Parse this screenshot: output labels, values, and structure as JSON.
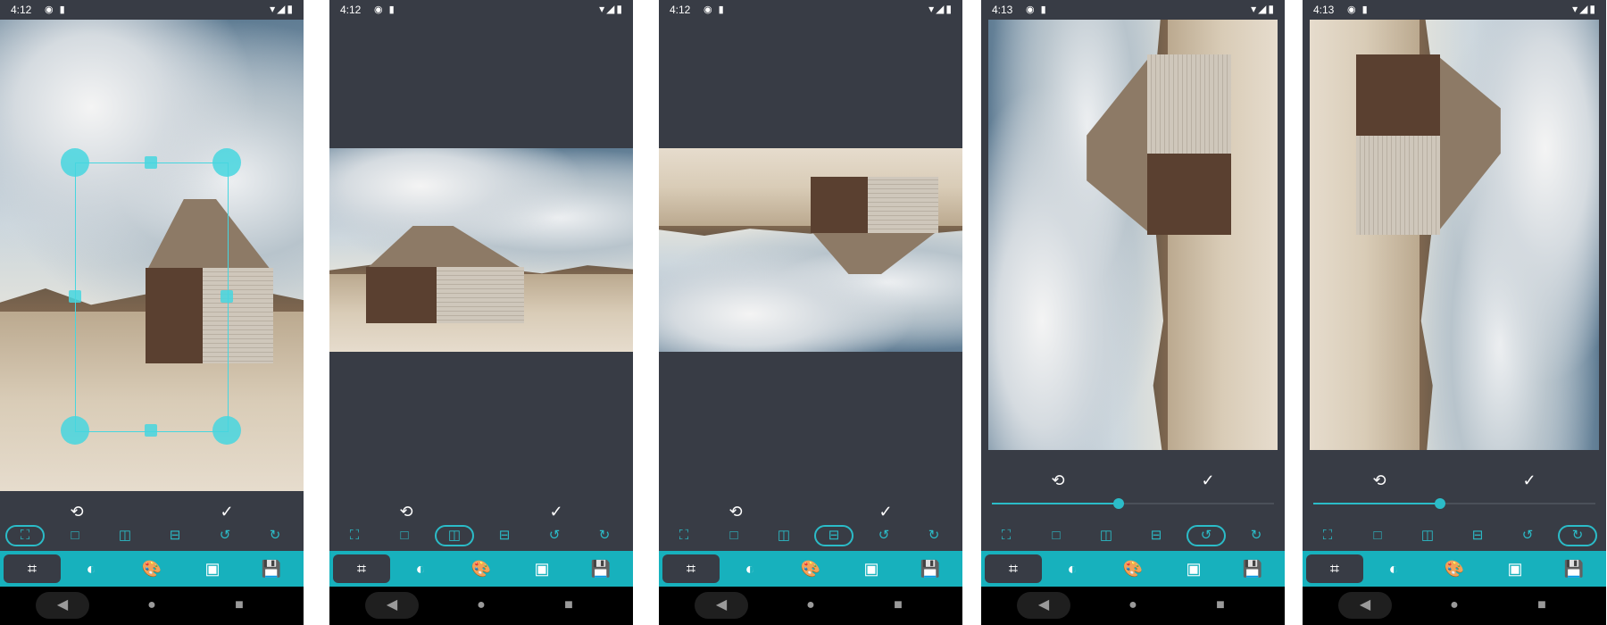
{
  "colors": {
    "accent": "#17b1bd",
    "panel": "#383c45",
    "icon": "#2bbcc8"
  },
  "screens": [
    {
      "time": "4:12",
      "active_tool": "crop-free",
      "active_tab": "crop"
    },
    {
      "time": "4:12",
      "active_tool": "flip-horizontal",
      "active_tab": "crop"
    },
    {
      "time": "4:12",
      "active_tool": "flip-vertical",
      "active_tab": "crop"
    },
    {
      "time": "4:13",
      "active_tool": "rotate-left",
      "active_tab": "crop",
      "slider_fraction": 0.45
    },
    {
      "time": "4:13",
      "active_tool": "rotate-right",
      "active_tab": "crop",
      "slider_fraction": 0.45
    }
  ],
  "glyphs": {
    "reset": "⟲",
    "done": "✓",
    "crop_free": "⛶",
    "square": "□",
    "flip_h": "◫",
    "flip_v": "⊟",
    "rotate_left": "↺",
    "rotate_right": "↻",
    "tab_crop": "⌗",
    "tab_brightness": "◐",
    "tab_palette": "🎨",
    "tab_image": "▣",
    "tab_save": "💾",
    "nav_back": "◀",
    "nav_home": "●",
    "nav_recent": "■",
    "status_noti": "◉ ▮",
    "status_sys": "▾◢▮"
  }
}
